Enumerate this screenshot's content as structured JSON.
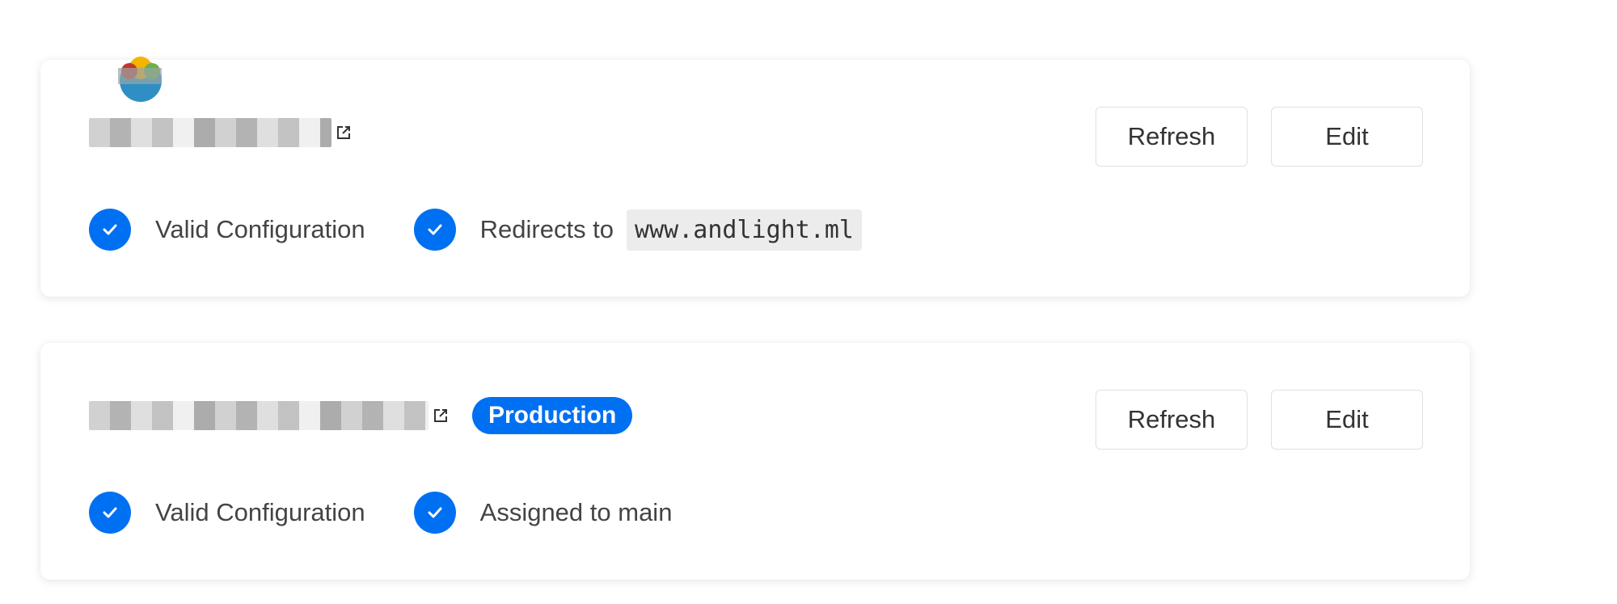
{
  "domains": [
    {
      "redirect_label": "Redirects to",
      "redirect_target": "www.andlight.ml",
      "status_label": "Valid Configuration",
      "refresh_label": "Refresh",
      "edit_label": "Edit",
      "logo_icon": "fruit-bowl-logo-icon"
    },
    {
      "badge": "Production",
      "status_label": "Valid Configuration",
      "assigned_label": "Assigned to main",
      "refresh_label": "Refresh",
      "edit_label": "Edit"
    }
  ],
  "colors": {
    "accent": "#0070f3",
    "card_bg": "#ffffff",
    "code_bg": "#ececec"
  }
}
